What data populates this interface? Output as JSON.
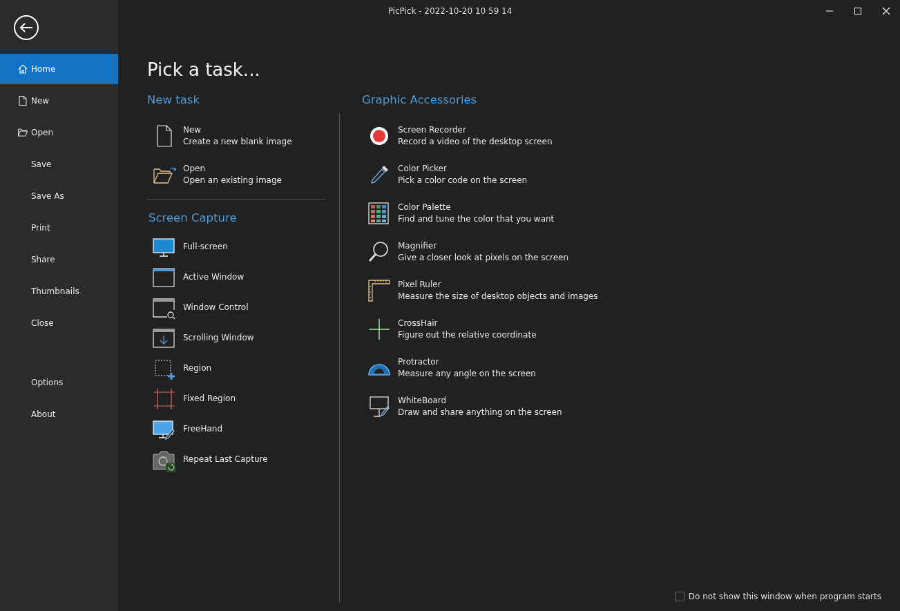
{
  "window": {
    "title": "PicPick - 2022-10-20 10 59 14"
  },
  "sidebar": {
    "items": [
      {
        "label": "Home",
        "selected": true
      },
      {
        "label": "New",
        "selected": false
      },
      {
        "label": "Open",
        "selected": false
      },
      {
        "label": "Save",
        "selected": false
      },
      {
        "label": "Save As",
        "selected": false
      },
      {
        "label": "Print",
        "selected": false
      },
      {
        "label": "Share",
        "selected": false
      },
      {
        "label": "Thumbnails",
        "selected": false
      },
      {
        "label": "Close",
        "selected": false
      }
    ],
    "bottom_items": [
      {
        "label": "Options",
        "selected": false
      },
      {
        "label": "About",
        "selected": false
      }
    ]
  },
  "heading": "Pick a task...",
  "new_task": {
    "title": "New task",
    "items": [
      {
        "title": "New",
        "description": "Create a new blank image"
      },
      {
        "title": "Open",
        "description": "Open an existing image"
      }
    ]
  },
  "screen_capture": {
    "title": "Screen Capture",
    "items": [
      "Full-screen",
      "Active Window",
      "Window Control",
      "Scrolling Window",
      "Region",
      "Fixed Region",
      "FreeHand",
      "Repeat Last Capture"
    ]
  },
  "graphic_accessories": {
    "title": "Graphic Accessories",
    "items": [
      {
        "title": "Screen Recorder",
        "description": "Record a video of the desktop screen"
      },
      {
        "title": "Color Picker",
        "description": "Pick a color code on the screen"
      },
      {
        "title": "Color Palette",
        "description": "Find and tune the color that you want"
      },
      {
        "title": "Magnifier",
        "description": "Give a closer look at pixels on the screen"
      },
      {
        "title": "Pixel Ruler",
        "description": "Measure the size of desktop objects and images"
      },
      {
        "title": "CrossHair",
        "description": "Figure out the relative coordinate"
      },
      {
        "title": "Protractor",
        "description": "Measure any angle on the screen"
      },
      {
        "title": "WhiteBoard",
        "description": "Draw and share anything on the screen"
      }
    ]
  },
  "footer": {
    "checkbox": {
      "label": "Do not show this window when program starts",
      "checked": false
    }
  }
}
